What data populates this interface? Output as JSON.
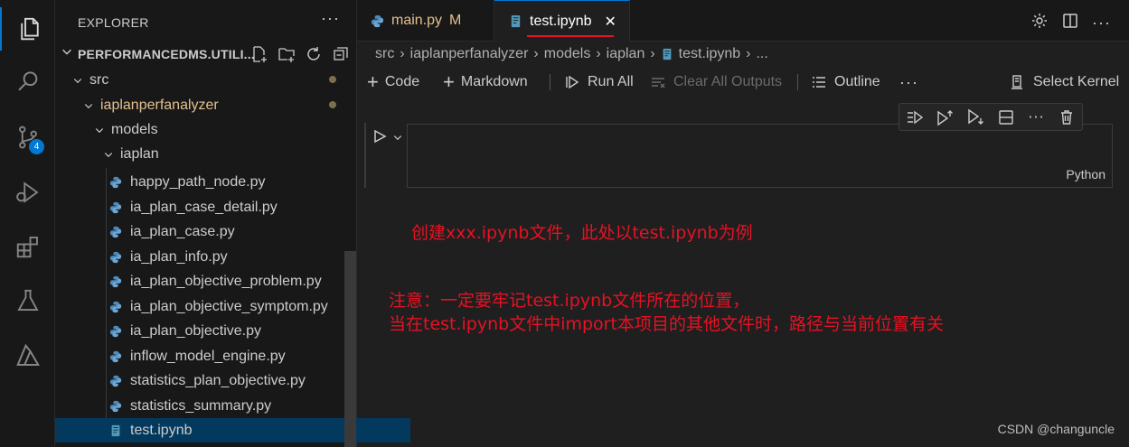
{
  "activity_bar": {
    "scm_badge": "4"
  },
  "explorer": {
    "title": "EXPLORER",
    "more_label": "···",
    "project_name": "PERFORMANCEDMS.UTILI...",
    "tree": [
      {
        "label": "src",
        "type": "folder",
        "modified": true
      },
      {
        "label": "iaplanperfanalyzer",
        "type": "folder",
        "modified": true
      },
      {
        "label": "models",
        "type": "folder"
      },
      {
        "label": "iaplan",
        "type": "folder"
      },
      {
        "label": "happy_path_node.py",
        "type": "python"
      },
      {
        "label": "ia_plan_case_detail.py",
        "type": "python"
      },
      {
        "label": "ia_plan_case.py",
        "type": "python"
      },
      {
        "label": "ia_plan_info.py",
        "type": "python"
      },
      {
        "label": "ia_plan_objective_problem.py",
        "type": "python"
      },
      {
        "label": "ia_plan_objective_symptom.py",
        "type": "python"
      },
      {
        "label": "ia_plan_objective.py",
        "type": "python"
      },
      {
        "label": "inflow_model_engine.py",
        "type": "python"
      },
      {
        "label": "statistics_plan_objective.py",
        "type": "python"
      },
      {
        "label": "statistics_summary.py",
        "type": "python"
      },
      {
        "label": "test.ipynb",
        "type": "notebook",
        "selected": true
      }
    ]
  },
  "tabs": [
    {
      "label": "main.py",
      "status": "M"
    },
    {
      "label": "test.ipynb",
      "close": "✕"
    }
  ],
  "breadcrumb": [
    "src",
    "iaplanperfanalyzer",
    "models",
    "iaplan",
    "test.ipynb",
    "..."
  ],
  "toolbar": {
    "code": "Code",
    "markdown": "Markdown",
    "run_all": "Run All",
    "clear_outputs": "Clear All Outputs",
    "outline": "Outline",
    "more": "···",
    "select_kernel": "Select Kernel"
  },
  "cell": {
    "language": "Python",
    "more": "···"
  },
  "annotations": {
    "line1": "创建xxx.ipynb文件，此处以test.ipynb为例",
    "line2": "注意：一定要牢记test.ipynb文件所在的位置，",
    "line3": "当在test.ipynb文件中import本项目的其他文件时，路径与当前位置有关"
  },
  "watermark": "CSDN @changuncle",
  "colors": {
    "accent": "#0078d4",
    "annotation": "#e81123",
    "modified": "#e2c08d",
    "selected_row": "#04395e"
  }
}
